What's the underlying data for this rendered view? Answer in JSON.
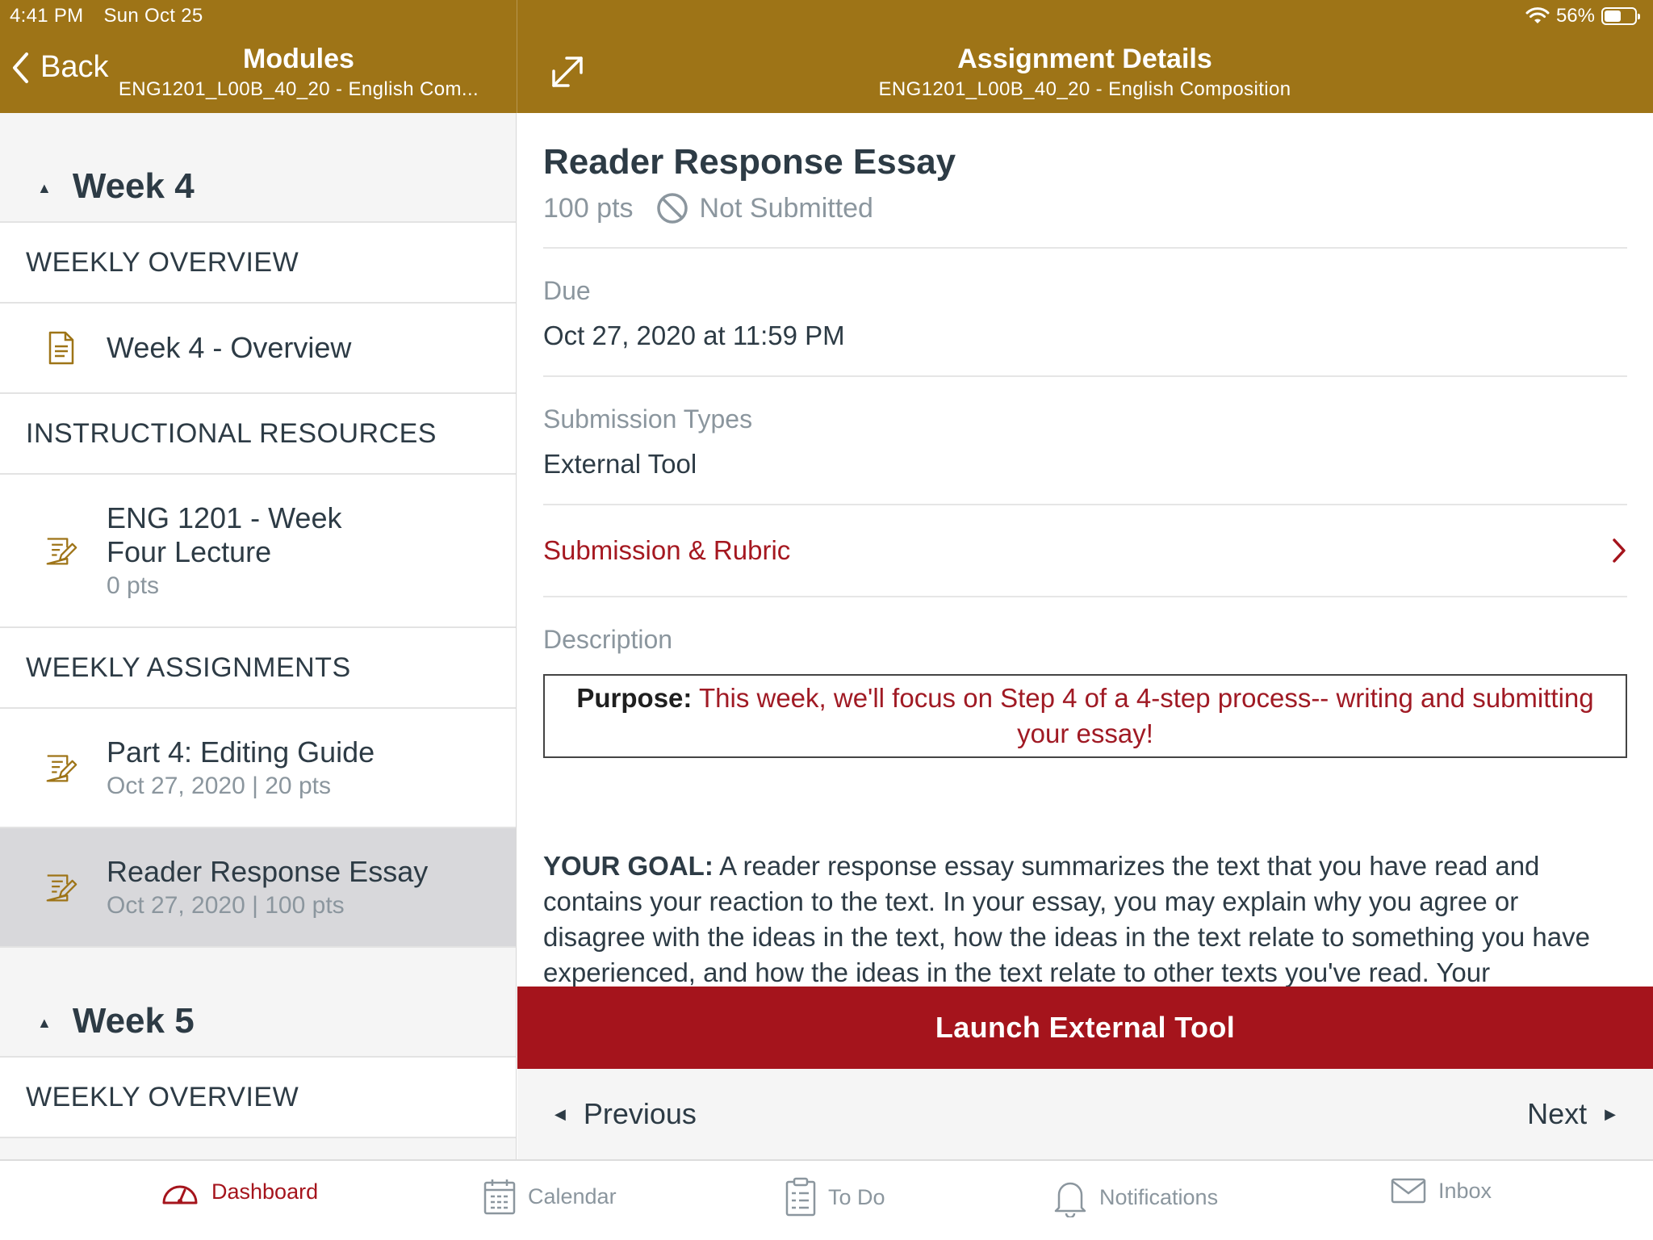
{
  "status_bar": {
    "time": "4:41 PM",
    "date": "Sun Oct 25",
    "battery": "56%",
    "battery_level": 0.56
  },
  "left_header": {
    "back_label": "Back",
    "title": "Modules",
    "subtitle": "ENG1201_L00B_40_20 - English Com..."
  },
  "right_header": {
    "title": "Assignment Details",
    "subtitle": "ENG1201_L00B_40_20 - English Composition"
  },
  "modules": {
    "week4": {
      "title": "Week 4",
      "weekly_overview": "WEEKLY OVERVIEW",
      "overview_item": "Week 4 - Overview",
      "instructional_resources": "INSTRUCTIONAL RESOURCES",
      "lecture": {
        "name": "ENG 1201 - Week Four Lecture",
        "meta": "0 pts"
      },
      "weekly_assignments": "WEEKLY ASSIGNMENTS",
      "editing_guide": {
        "name": "Part 4: Editing Guide",
        "meta": "Oct 27, 2020 | 20 pts"
      },
      "essay": {
        "name": "Reader Response Essay",
        "meta": "Oct 27, 2020 | 100 pts"
      }
    },
    "week5": {
      "title": "Week 5",
      "weekly_overview": "WEEKLY OVERVIEW"
    }
  },
  "assignment": {
    "title": "Reader Response Essay",
    "points": "100 pts",
    "status": "Not Submitted",
    "due_label": "Due",
    "due_value": "Oct 27, 2020 at 11:59 PM",
    "submission_types_label": "Submission Types",
    "submission_types_value": "External Tool",
    "submission_rubric": "Submission & Rubric",
    "description_label": "Description",
    "purpose_label": "Purpose:",
    "purpose_text": " This week, we'll focus on Step 4 of a 4-step process-- writing and submitting your essay!",
    "goal_label": "YOUR GOAL:",
    "goal_text": " A reader response essay summarizes the text that you have read and contains your reaction to the text. In your essay, you may explain why you agree or disagree with the ideas in the text, how the ideas in the text relate to something you have experienced, and how the ideas in the text relate to other texts you've read. Your"
  },
  "actions": {
    "launch": "Launch External Tool",
    "previous": "Previous",
    "next": "Next"
  },
  "tabs": [
    {
      "label": "Dashboard",
      "icon": "dashboard-icon"
    },
    {
      "label": "Calendar",
      "icon": "calendar-icon"
    },
    {
      "label": "To Do",
      "icon": "todo-icon"
    },
    {
      "label": "Notifications",
      "icon": "bell-icon"
    },
    {
      "label": "Inbox",
      "icon": "mail-icon"
    }
  ],
  "colors": {
    "header": "#9e7417",
    "accent": "#a5141c",
    "text": "#2d3b45",
    "muted": "#8b969e"
  }
}
